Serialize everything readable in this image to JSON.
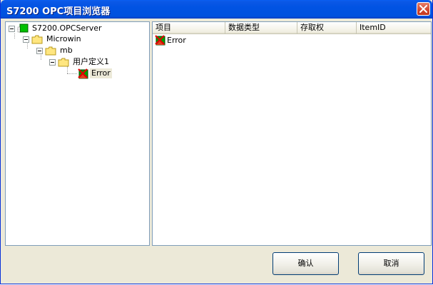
{
  "window": {
    "title": "S7200 OPC项目浏览器"
  },
  "tree": {
    "nodes": [
      {
        "label": "S7200.OPCServer",
        "icon": "server-icon"
      },
      {
        "label": "Microwin",
        "icon": "folder-icon"
      },
      {
        "label": "mb",
        "icon": "folder-icon"
      },
      {
        "label": "用户定义1",
        "icon": "folder-icon"
      },
      {
        "label": "Error",
        "icon": "error-icon"
      }
    ]
  },
  "list": {
    "columns": [
      "项目",
      "数据类型",
      "存取权",
      "ItemID"
    ],
    "rows": [
      {
        "item": "Error",
        "icon": "error-icon"
      }
    ]
  },
  "buttons": {
    "ok": "确认",
    "cancel": "取消"
  },
  "colors": {
    "title_bar": "#0052de",
    "dialog_face": "#ece9d8",
    "close_button": "#d2462e",
    "pane_border": "#7f9db9"
  }
}
